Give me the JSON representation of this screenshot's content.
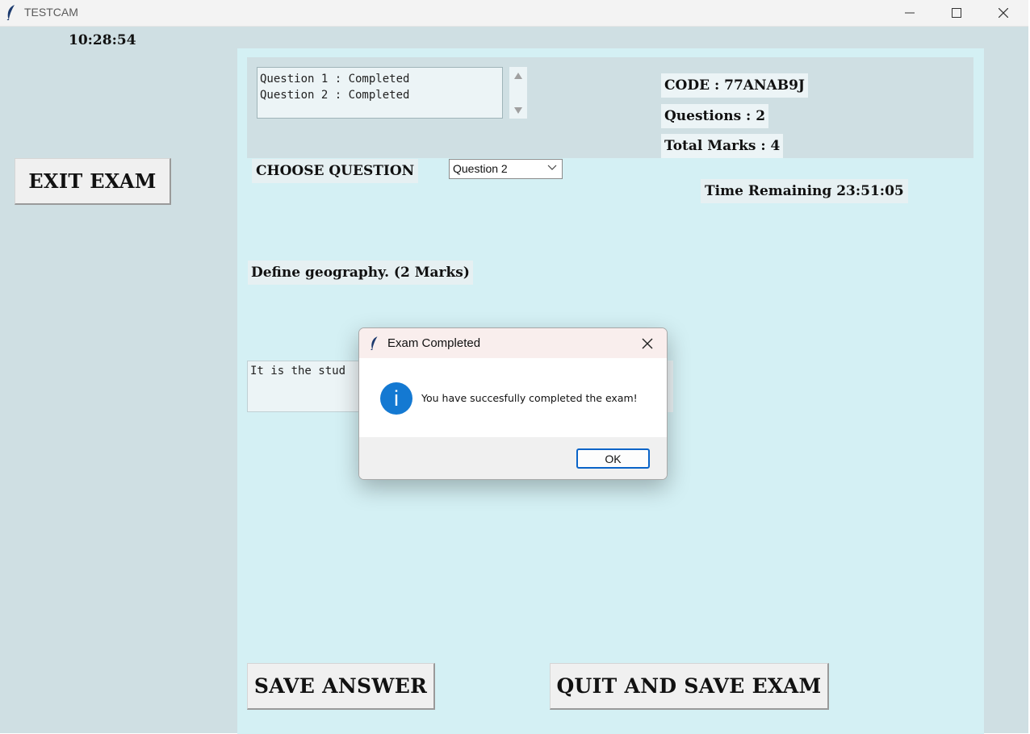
{
  "window": {
    "title": "TESTCAM",
    "icons": [
      "feather-icon",
      "minimize-icon",
      "maximize-icon",
      "close-icon"
    ]
  },
  "clock": "10:28:54",
  "exit_button": "EXIT EXAM",
  "status_list": [
    "Question 1 : Completed",
    "Question 2 : Completed"
  ],
  "info": {
    "code": "CODE : 77ANAB9J",
    "questions": "Questions : 2",
    "total_marks": "Total Marks : 4"
  },
  "choose_question": {
    "label": "CHOOSE QUESTION",
    "selected": "Question 2"
  },
  "time_remaining": "Time Remaining 23:51:05",
  "question_text": "Define geography. (2 Marks)",
  "answer_text": "It is the stud",
  "buttons": {
    "save": "SAVE ANSWER",
    "quit": "QUIT AND SAVE EXAM"
  },
  "dialog": {
    "title": "Exam Completed",
    "message": "You have succesfully completed the exam!",
    "ok": "OK",
    "info_glyph": "i",
    "accent": "#1479d2"
  }
}
